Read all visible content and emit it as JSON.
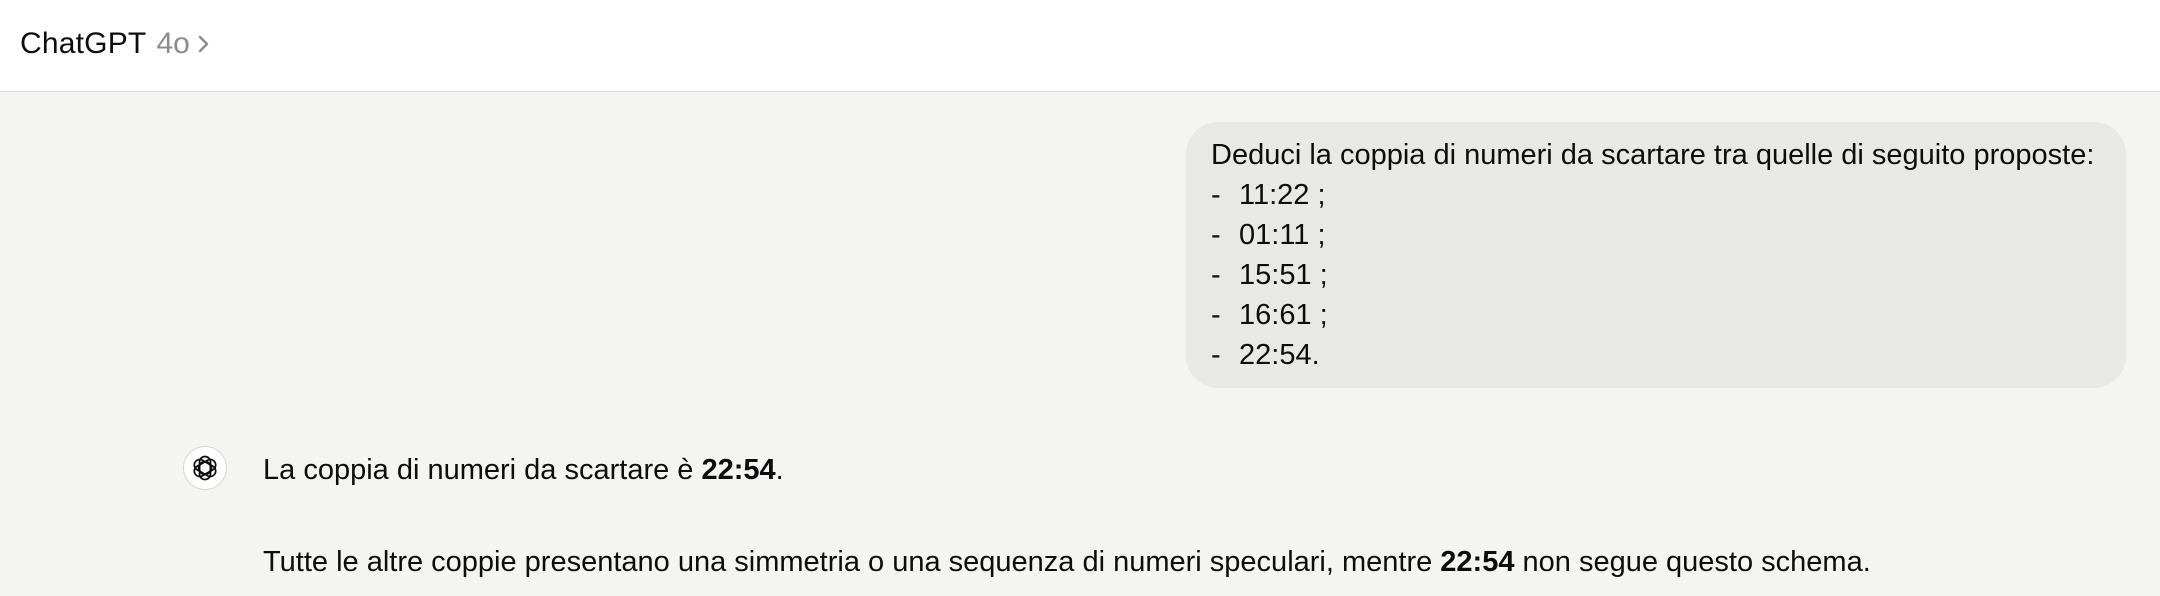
{
  "header": {
    "app_title": "ChatGPT",
    "model_name": "4o",
    "chevron_icon": "chevron-right-icon"
  },
  "user_message": {
    "intro": "Deduci la coppia di numeri da scartare tra quelle di seguito proposte:",
    "bullet": "-",
    "items": [
      "11:22 ;",
      "01:11 ;",
      "15:51 ;",
      "16:61 ;",
      "22:54."
    ]
  },
  "assistant_message": {
    "avatar_icon": "openai-logo-icon",
    "line1_pre": "La coppia di numeri da scartare è ",
    "line1_bold": "22:54",
    "line1_post": ".",
    "line2_pre": "Tutte le altre coppie presentano una simmetria o una sequenza di numeri speculari, mentre ",
    "line2_bold": "22:54",
    "line2_post": " non segue questo schema."
  },
  "colors": {
    "page_background": "#f4f4f3",
    "header_background": "#ffffff",
    "user_bubble": "#e8e8e6",
    "model_name_text": "#8b8b8b"
  }
}
